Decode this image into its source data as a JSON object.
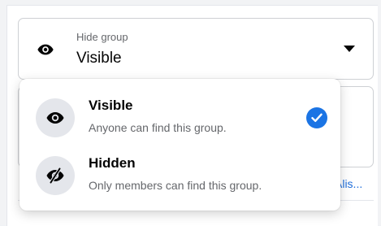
{
  "select": {
    "label": "Hide group",
    "value": "Visible",
    "icon": "eye-icon"
  },
  "dropdown": {
    "options": [
      {
        "title": "Visible",
        "description": "Anyone can find this group.",
        "icon": "eye-icon",
        "selected": true
      },
      {
        "title": "Hidden",
        "description": "Only members can find this group.",
        "icon": "eye-slash-icon",
        "selected": false
      }
    ]
  },
  "background": {
    "link_text": "Alis..."
  },
  "colors": {
    "accent": "#1b74e4",
    "text_primary": "#050505",
    "text_secondary": "#65676b",
    "icon_bg": "#e4e6eb"
  }
}
